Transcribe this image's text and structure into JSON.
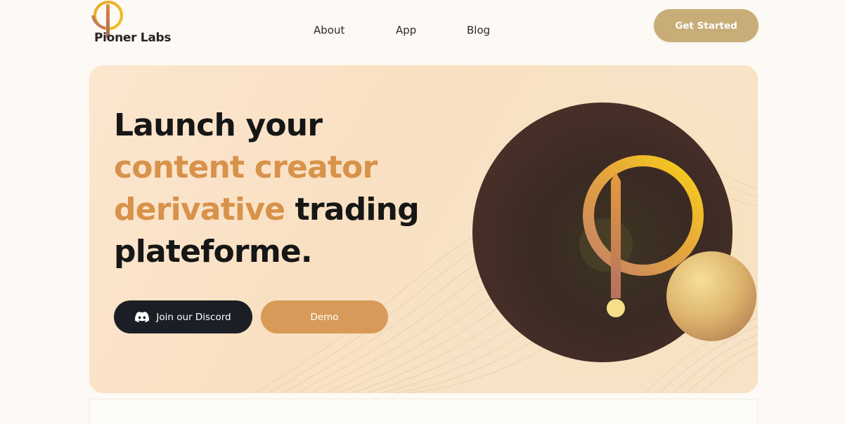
{
  "brand": {
    "name": "Pioner Labs",
    "logo_icon": "pioneer-logo-icon"
  },
  "nav": {
    "items": [
      {
        "label": "About"
      },
      {
        "label": "App"
      },
      {
        "label": "Blog"
      }
    ],
    "cta_label": "Get Started"
  },
  "hero": {
    "headline": {
      "line1": "Launch your",
      "line2_accent": "content creator",
      "line3_accent": "derivative",
      "line3_rest": "trading",
      "line4": "plateforme."
    },
    "discord_button_label": "Join our Discord",
    "discord_icon": "discord-icon",
    "demo_button_label": "Demo",
    "illustration": "pioneer-symbol-sphere"
  },
  "colors": {
    "accent": "#d8924a",
    "cta": "#c8ad78",
    "dark": "#1c1e26",
    "demo": "#d89a58",
    "hero_bg": "#fbe6cf"
  }
}
